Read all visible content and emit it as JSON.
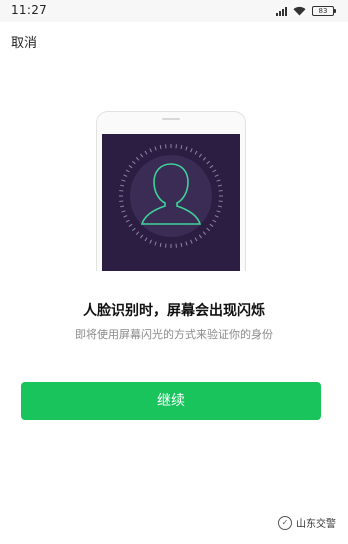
{
  "status_bar": {
    "time": "11:27",
    "battery": "83",
    "icons": [
      "signal-icon",
      "wifi-icon",
      "battery-icon"
    ]
  },
  "header": {
    "cancel_label": "取消"
  },
  "illustration": {
    "screen_color": "#2b1e42",
    "face_outline_color": "#3fd39a",
    "icons": [
      "phone-outline-icon",
      "face-silhouette-icon"
    ]
  },
  "main": {
    "title": "人脸识别时，屏幕会出现闪烁",
    "subtitle": "即将使用屏幕闪光的方式来验证你的身份"
  },
  "actions": {
    "continue_label": "继续",
    "accent_color": "#19c45d"
  },
  "watermark": {
    "text": "山东交警",
    "icon": "wechat-channel-icon"
  }
}
